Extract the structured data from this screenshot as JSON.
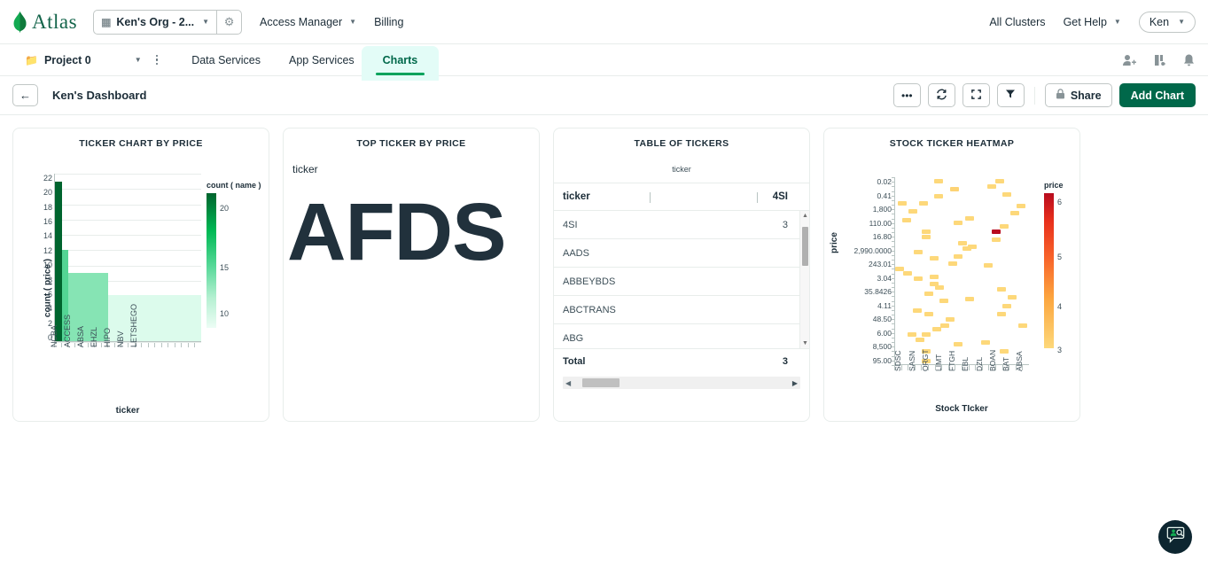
{
  "topnav": {
    "brand": "Atlas",
    "org_name": "Ken's Org - 2...",
    "org_icon": "org-building-icon",
    "gear_icon": "gear-icon",
    "links": [
      {
        "label": "Access Manager",
        "has_caret": true
      },
      {
        "label": "Billing",
        "has_caret": false
      }
    ],
    "all_clusters": "All Clusters",
    "get_help": "Get Help",
    "user": "Ken"
  },
  "projectbar": {
    "project_name": "Project 0",
    "folder_icon": "folder-icon",
    "kebab_icon": "kebab-menu-icon",
    "tabs": [
      {
        "label": "Data Services",
        "active": false
      },
      {
        "label": "App Services",
        "active": false
      },
      {
        "label": "Charts",
        "active": true
      }
    ],
    "icons": [
      "invite-user-icon",
      "access-manager-icon",
      "notification-bell-icon"
    ]
  },
  "dashbar": {
    "back_icon": "arrow-left-icon",
    "title": "Ken's Dashboard",
    "more_label": "•••",
    "refresh_icon": "refresh-icon",
    "fullscreen_icon": "fullscreen-icon",
    "filter_icon": "filter-icon",
    "lock_icon": "lock-icon",
    "share_label": "Share",
    "add_chart_label": "Add Chart"
  },
  "colors": {
    "brand_green": "#00684a",
    "accent_green": "#00a35c",
    "tab_bg": "#e3fcf7",
    "text_dark": "#1c2d38",
    "border": "#e8edeb",
    "heat_high": "#b80b1e",
    "heat_low": "#fdd87a"
  },
  "chart_data": [
    {
      "type": "bar",
      "title": "TICKER CHART BY PRICE",
      "xlabel": "ticker",
      "ylabel": "count ( price )",
      "ylim": [
        0,
        22
      ],
      "yticks": [
        22,
        20,
        18,
        16,
        14,
        12,
        10,
        8,
        6,
        4,
        2,
        0
      ],
      "grid": true,
      "categories": [
        "NCBA",
        "ACCESS",
        "ABSA",
        "EHZL",
        "HIPO",
        "NBV",
        "LETSHEGO"
      ],
      "tick_labels_positions": [
        0,
        2,
        4,
        6,
        8,
        10,
        12
      ],
      "values": [
        21,
        12,
        9,
        9,
        9,
        9,
        9,
        9,
        6,
        6,
        6,
        6,
        6,
        6,
        6,
        6,
        6,
        6,
        6,
        6,
        6,
        6
      ],
      "bar_colors": [
        "#00642e",
        "#53d594",
        "#86e4b4",
        "#86e4b4",
        "#86e4b4",
        "#86e4b4",
        "#86e4b4",
        "#86e4b4",
        "#dcfbec",
        "#dcfbec",
        "#dcfbec",
        "#dcfbec",
        "#dcfbec",
        "#dcfbec",
        "#dcfbec",
        "#dcfbec",
        "#dcfbec",
        "#dcfbec",
        "#dcfbec",
        "#dcfbec",
        "#dcfbec",
        "#dcfbec"
      ],
      "legend": {
        "title": "count ( name )",
        "position": "right",
        "ticks": [
          "20",
          "15",
          "10"
        ],
        "tick_offsets_pct": [
          8,
          52,
          86
        ],
        "gradient_from": "#00642e",
        "gradient_to": "#ecfdf5"
      }
    },
    {
      "type": "text",
      "title": "TOP TICKER BY PRICE",
      "field_label": "ticker",
      "value": "AFDS"
    },
    {
      "type": "table",
      "title": "TABLE OF TICKERS",
      "subtitle": "ticker",
      "columns": [
        "ticker",
        "4SI"
      ],
      "rows": [
        {
          "ticker": "4SI",
          "value": "3"
        },
        {
          "ticker": "AADS",
          "value": ""
        },
        {
          "ticker": "ABBEYBDS",
          "value": ""
        },
        {
          "ticker": "ABCTRANS",
          "value": ""
        },
        {
          "ticker": "ABG",
          "value": ""
        }
      ],
      "total_label": "Total",
      "total_value": "3"
    },
    {
      "type": "heatmap",
      "title": "STOCK TICKER HEATMAP",
      "xlabel": "Stock TIcker",
      "ylabel": "price",
      "x_categories": [
        "SDSC",
        "SASN",
        "ORGT",
        "LIMT",
        "FTGH",
        "EBL",
        "DZL",
        "BOAN",
        "BAT",
        "ABSA"
      ],
      "y_categories": [
        "0.02",
        "0.41",
        "1,800",
        "110.00",
        "16.80",
        "2,990.0000",
        "243.01",
        "3.04",
        "35.8426",
        "4.11",
        "48.50",
        "6.00",
        "8,500",
        "95.00"
      ],
      "legend": {
        "title": "price",
        "ticks": [
          "6",
          "5",
          "4",
          "3"
        ],
        "tick_offsets_pct": [
          3,
          38,
          70,
          98
        ],
        "gradient_from": "#b80b1e",
        "gradient_to": "#fdd87a"
      },
      "cells": [
        {
          "x": 29,
          "y": 1,
          "v": 3.0
        },
        {
          "x": 41,
          "y": 5,
          "v": 3.1
        },
        {
          "x": 29,
          "y": 9,
          "v": 3.0
        },
        {
          "x": 69,
          "y": 4,
          "v": 3.0
        },
        {
          "x": 75,
          "y": 1,
          "v": 3.0
        },
        {
          "x": 80,
          "y": 8,
          "v": 3.0
        },
        {
          "x": 2,
          "y": 13,
          "v": 3.0
        },
        {
          "x": 18,
          "y": 13,
          "v": 3.0
        },
        {
          "x": 10,
          "y": 17,
          "v": 3.0
        },
        {
          "x": 5,
          "y": 22,
          "v": 3.0
        },
        {
          "x": 86,
          "y": 18,
          "v": 3.0
        },
        {
          "x": 91,
          "y": 14,
          "v": 3.0
        },
        {
          "x": 20,
          "y": 28,
          "v": 3.0
        },
        {
          "x": 20,
          "y": 31,
          "v": 3.0
        },
        {
          "x": 44,
          "y": 23,
          "v": 3.0
        },
        {
          "x": 52,
          "y": 21,
          "v": 3.0
        },
        {
          "x": 78,
          "y": 25,
          "v": 3.0
        },
        {
          "x": 72,
          "y": 28,
          "v": 6.0
        },
        {
          "x": 72,
          "y": 32,
          "v": 3.0
        },
        {
          "x": 47,
          "y": 34,
          "v": 3.0
        },
        {
          "x": 50,
          "y": 37,
          "v": 3.0
        },
        {
          "x": 54,
          "y": 36,
          "v": 3.0
        },
        {
          "x": 14,
          "y": 39,
          "v": 3.0
        },
        {
          "x": 26,
          "y": 42,
          "v": 3.0
        },
        {
          "x": 44,
          "y": 41,
          "v": 3.0
        },
        {
          "x": 40,
          "y": 45,
          "v": 3.0
        },
        {
          "x": 0,
          "y": 48,
          "v": 3.0
        },
        {
          "x": 6,
          "y": 50,
          "v": 3.0
        },
        {
          "x": 66,
          "y": 46,
          "v": 3.0
        },
        {
          "x": 14,
          "y": 53,
          "v": 3.0
        },
        {
          "x": 26,
          "y": 52,
          "v": 3.0
        },
        {
          "x": 26,
          "y": 56,
          "v": 3.0
        },
        {
          "x": 30,
          "y": 58,
          "v": 3.0
        },
        {
          "x": 22,
          "y": 61,
          "v": 3.0
        },
        {
          "x": 76,
          "y": 59,
          "v": 3.0
        },
        {
          "x": 84,
          "y": 63,
          "v": 3.0
        },
        {
          "x": 52,
          "y": 64,
          "v": 3.0
        },
        {
          "x": 33,
          "y": 65,
          "v": 3.0
        },
        {
          "x": 80,
          "y": 68,
          "v": 3.0
        },
        {
          "x": 13,
          "y": 70,
          "v": 3.0
        },
        {
          "x": 22,
          "y": 72,
          "v": 3.0
        },
        {
          "x": 76,
          "y": 72,
          "v": 3.0
        },
        {
          "x": 38,
          "y": 75,
          "v": 3.0
        },
        {
          "x": 34,
          "y": 78,
          "v": 3.0
        },
        {
          "x": 92,
          "y": 78,
          "v": 3.0
        },
        {
          "x": 28,
          "y": 80,
          "v": 3.0
        },
        {
          "x": 9,
          "y": 83,
          "v": 3.0
        },
        {
          "x": 20,
          "y": 83,
          "v": 3.0
        },
        {
          "x": 15,
          "y": 86,
          "v": 3.0
        },
        {
          "x": 44,
          "y": 88,
          "v": 3.0
        },
        {
          "x": 64,
          "y": 87,
          "v": 3.0
        },
        {
          "x": 20,
          "y": 92,
          "v": 3.0
        },
        {
          "x": 78,
          "y": 92,
          "v": 3.0
        },
        {
          "x": 20,
          "y": 97,
          "v": 3.0
        }
      ]
    }
  ],
  "fab": {
    "icon": "chat-support-icon"
  }
}
